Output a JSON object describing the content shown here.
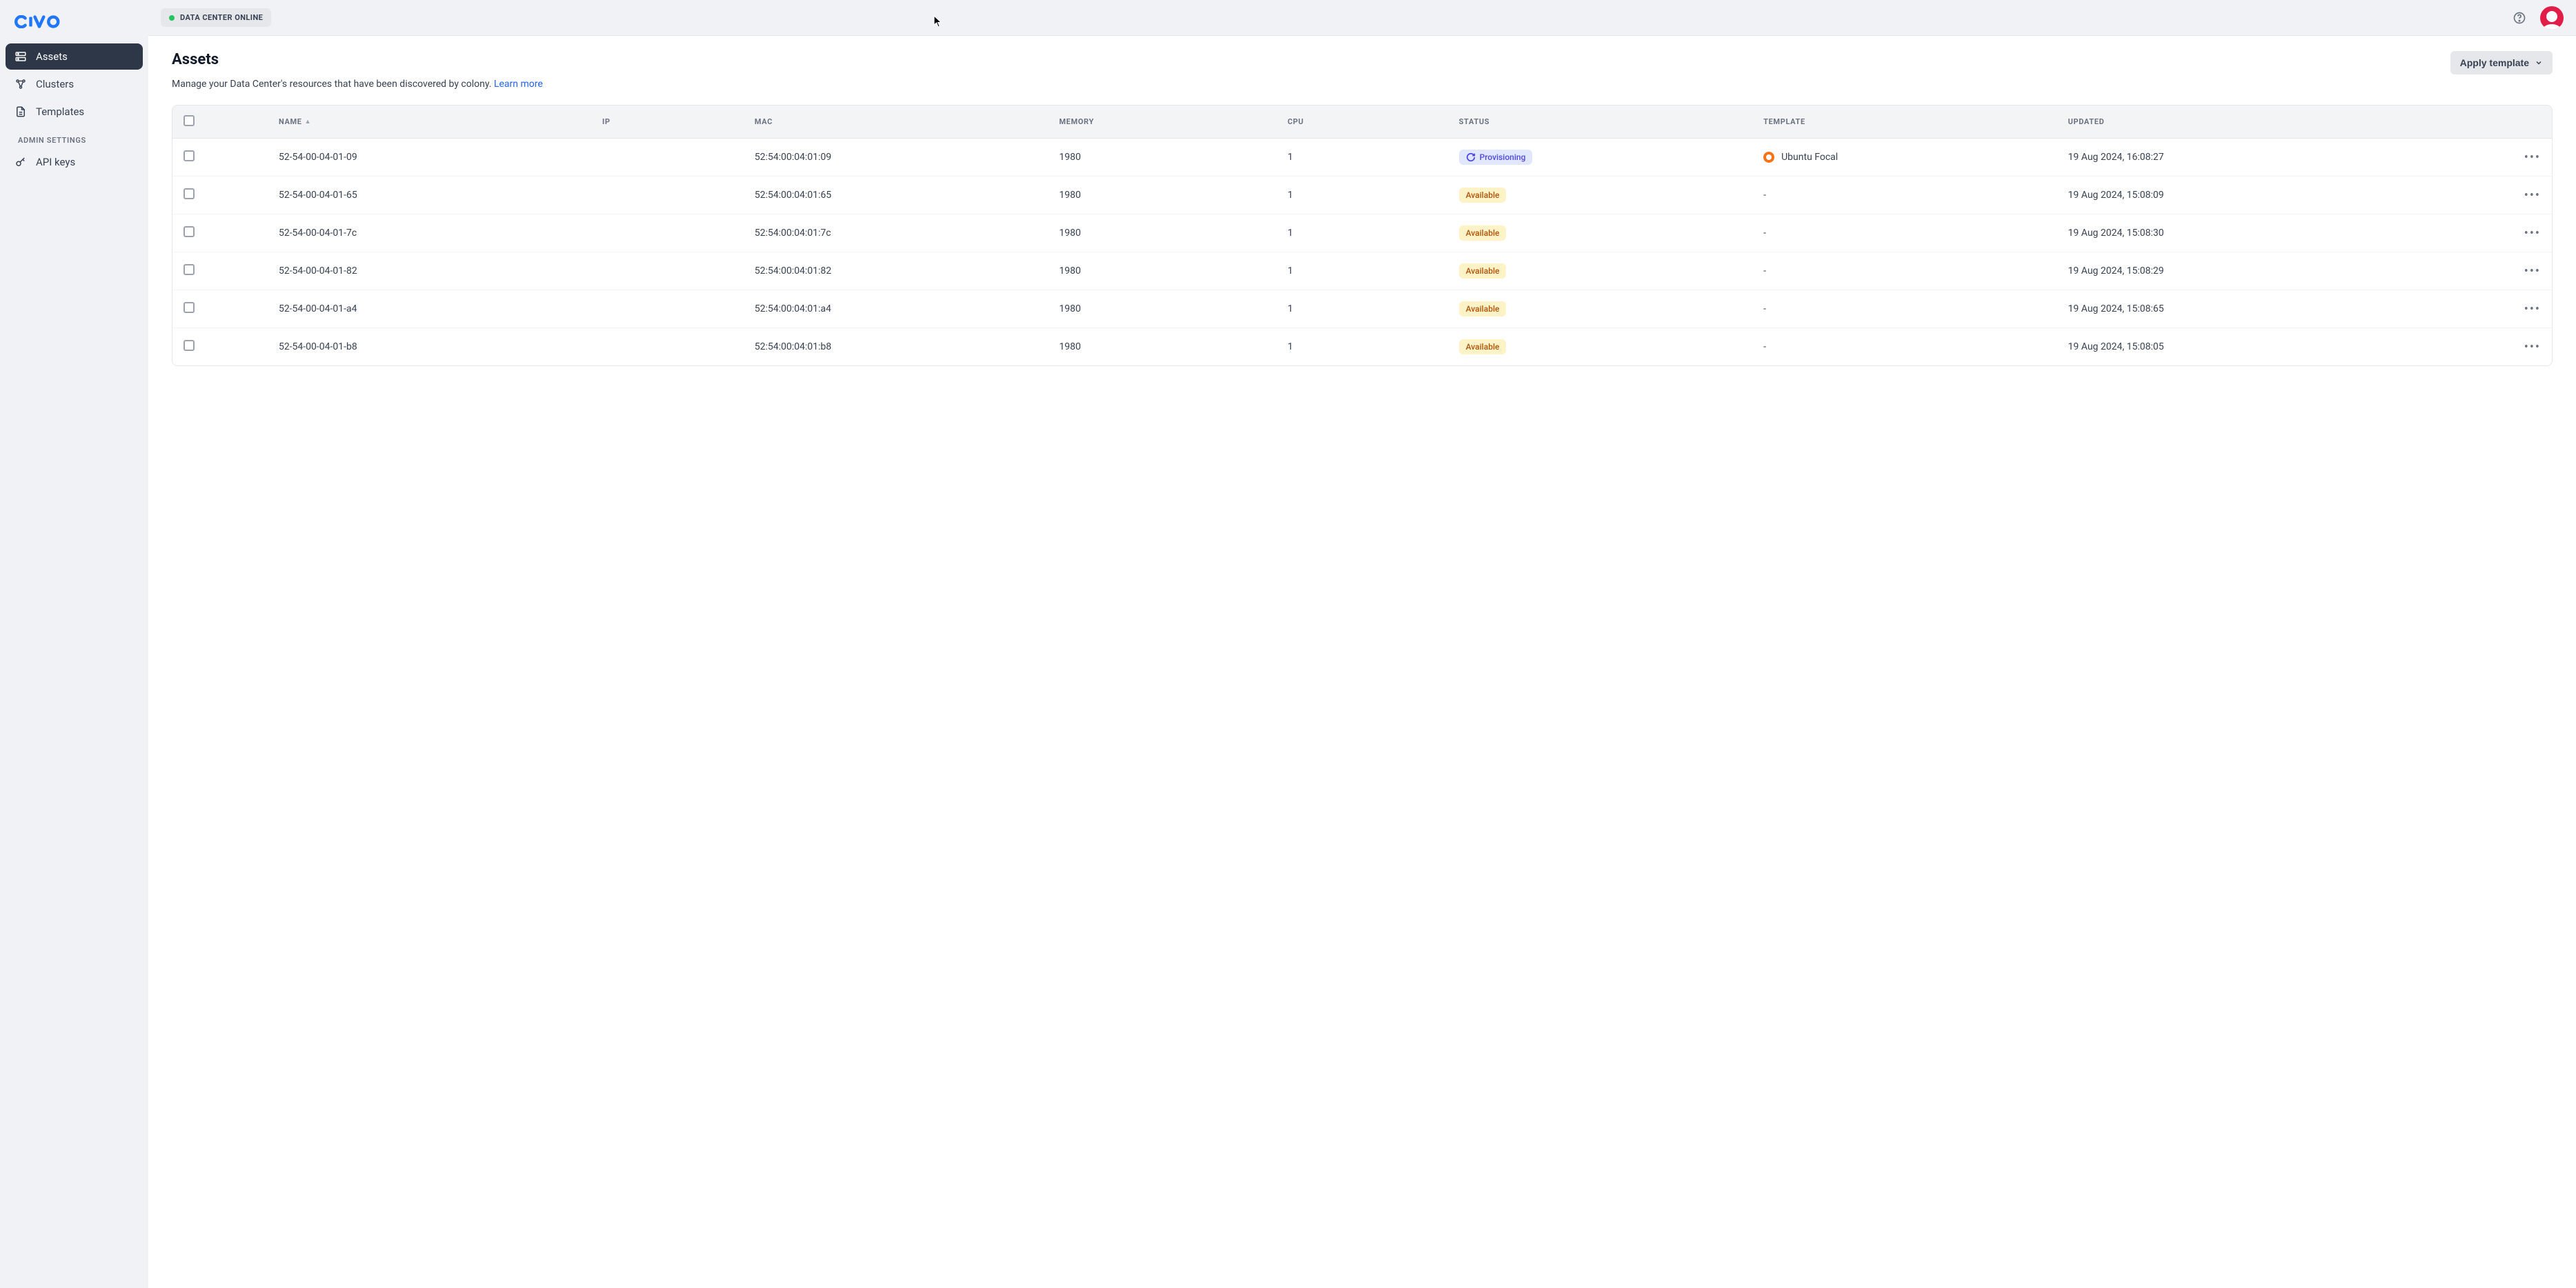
{
  "topbar": {
    "status_label": "DATA CENTER ONLINE"
  },
  "sidebar": {
    "items": [
      {
        "label": "Assets",
        "icon": "assets-icon",
        "active": true
      },
      {
        "label": "Clusters",
        "icon": "clusters-icon",
        "active": false
      },
      {
        "label": "Templates",
        "icon": "templates-icon",
        "active": false
      }
    ],
    "admin_heading": "ADMIN SETTINGS",
    "admin_items": [
      {
        "label": "API keys",
        "icon": "key-icon"
      }
    ]
  },
  "page": {
    "title": "Assets",
    "description": "Manage your Data Center's resources that have been discovered by colony.",
    "learn_more": "Learn more",
    "apply_template_label": "Apply template"
  },
  "table": {
    "columns": {
      "name": "NAME",
      "ip": "IP",
      "mac": "MAC",
      "memory": "MEMORY",
      "cpu": "CPU",
      "status": "STATUS",
      "template": "TEMPLATE",
      "updated": "UPDATED"
    },
    "sort_column": "name",
    "sort_dir": "asc",
    "rows": [
      {
        "name": "52-54-00-04-01-09",
        "ip": "",
        "mac": "52:54:00:04:01:09",
        "memory": "1980",
        "cpu": "1",
        "status": "Provisioning",
        "status_kind": "provisioning",
        "template": "Ubuntu Focal",
        "updated": "19 Aug 2024, 16:08:27"
      },
      {
        "name": "52-54-00-04-01-65",
        "ip": "",
        "mac": "52:54:00:04:01:65",
        "memory": "1980",
        "cpu": "1",
        "status": "Available",
        "status_kind": "available",
        "template": "-",
        "updated": "19 Aug 2024, 15:08:09"
      },
      {
        "name": "52-54-00-04-01-7c",
        "ip": "",
        "mac": "52:54:00:04:01:7c",
        "memory": "1980",
        "cpu": "1",
        "status": "Available",
        "status_kind": "available",
        "template": "-",
        "updated": "19 Aug 2024, 15:08:30"
      },
      {
        "name": "52-54-00-04-01-82",
        "ip": "",
        "mac": "52:54:00:04:01:82",
        "memory": "1980",
        "cpu": "1",
        "status": "Available",
        "status_kind": "available",
        "template": "-",
        "updated": "19 Aug 2024, 15:08:29"
      },
      {
        "name": "52-54-00-04-01-a4",
        "ip": "",
        "mac": "52:54:00:04:01:a4",
        "memory": "1980",
        "cpu": "1",
        "status": "Available",
        "status_kind": "available",
        "template": "-",
        "updated": "19 Aug 2024, 15:08:65"
      },
      {
        "name": "52-54-00-04-01-b8",
        "ip": "",
        "mac": "52:54:00:04:01:b8",
        "memory": "1980",
        "cpu": "1",
        "status": "Available",
        "status_kind": "available",
        "template": "-",
        "updated": "19 Aug 2024, 15:08:05"
      }
    ]
  }
}
